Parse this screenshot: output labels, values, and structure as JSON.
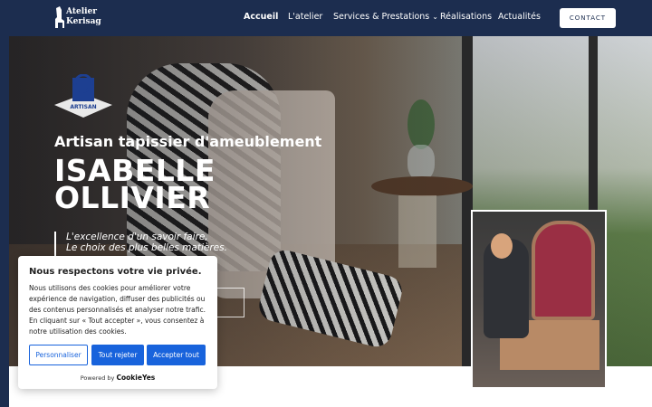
{
  "header": {
    "logo_line1": "Atelier",
    "logo_line2": "Kerisag",
    "nav": [
      {
        "label": "Accueil"
      },
      {
        "label": "L'atelier"
      },
      {
        "label": "Services & Prestations"
      },
      {
        "label": "Réalisations"
      },
      {
        "label": "Actualités"
      }
    ],
    "contact_label": "CONTACT"
  },
  "hero": {
    "badge_label": "ARTISAN",
    "subtitle": "Artisan tapissier d'ameublement",
    "title_line1": "ISABELLE",
    "title_line2": "OLLIVIER",
    "quote_line1": "L'excellence d'un savoir faire,",
    "quote_line2": "Le choix des plus belles matières."
  },
  "cookie": {
    "title": "Nous respectons votre vie privée.",
    "text": "Nous utilisons des cookies pour améliorer votre expérience de navigation, diffuser des publicités ou des contenus personnalisés et analyser notre trafic. En cliquant sur « Tout accepter », vous consentez à notre utilisation des cookies.",
    "customize_label": "Personnaliser",
    "reject_label": "Tout rejeter",
    "accept_label": "Accepter tout",
    "powered_by": "Powered by",
    "powered_brand": "CookieYes"
  },
  "colors": {
    "header_bg": "#1c2d4f",
    "cookie_button": "#1863dc"
  }
}
